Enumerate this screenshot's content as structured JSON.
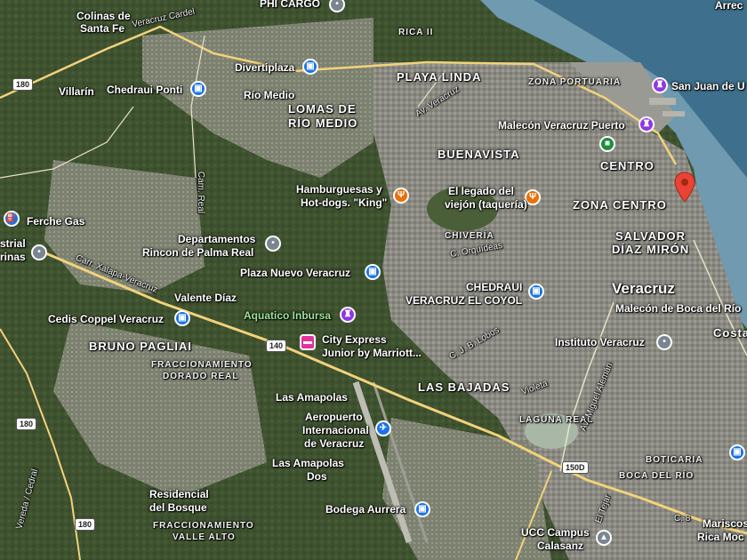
{
  "map": {
    "colors": {
      "sea": "#6f9ab0",
      "sea_deep": "#3e6f8c",
      "urban": "#8c8c84",
      "vegetation": "#3f5230",
      "road_major": "#f2d27a",
      "marker_red": "#ea4335"
    },
    "area_labels": [
      "Colinas de",
      "Santa Fe",
      "Villarín",
      "Río Medio",
      "LOMAS DE",
      "RÍO MEDIO",
      "PLAYA LINDA",
      "ZONA PORTUARIA",
      "BUENAVISTA",
      "CENTRO",
      "ZONA CENTRO",
      "SALVADOR",
      "DÍAZ MIRÓN",
      "Veracruz",
      "CHIVERÍA",
      "Valente Díaz",
      "BRUNO PAGLIAI",
      "FRACCIONAMIENTO",
      "DORADO REAL",
      "LAS BAJADAS",
      "LAGUNA REAL",
      "Las Amapolas",
      "Las Amapolas",
      "Dos",
      "Residencial",
      "del Bosque",
      "FRACCIONAMIENTO",
      "VALLE ALTO",
      "BOTICARIA",
      "BOCA DEL RÍO",
      "Arrec",
      "Costa",
      "RICA II",
      "strial",
      "rinas"
    ],
    "road_labels": [
      "Veracruz Cardel",
      "Av. Veracruz",
      "Carr. Xalapa-Veracruz",
      "Cam. Real",
      "C. Orquídeas",
      "C. J. B. Lobos",
      "Violeta",
      "Av. Miguel Alemán",
      "Vereda / Cedral",
      "El Tejar",
      "C. 8"
    ],
    "route_shields": [
      "180",
      "180",
      "180",
      "140",
      "150D"
    ],
    "places": [
      {
        "name": "PHI CARGO",
        "icon": "place-icon"
      },
      {
        "name": "Divertiplaza",
        "icon": "shopping-icon"
      },
      {
        "name": "Chedraui Ponti",
        "icon": "shopping-icon"
      },
      {
        "name": "San Juan de U",
        "icon": "landmark-icon"
      },
      {
        "name": "Malecón Veracruz Puerto",
        "icon": "landmark-icon"
      },
      {
        "name": "Hamburguesas y",
        "icon": "restaurant-icon"
      },
      {
        "name": "Hot-dogs. \"King\"",
        "icon": ""
      },
      {
        "name": "El legado del",
        "icon": "restaurant-icon"
      },
      {
        "name": "viejón (taquería)",
        "icon": ""
      },
      {
        "name": "Ferche Gas",
        "icon": "gas-station-icon"
      },
      {
        "name": "Departamentos",
        "icon": "place-icon"
      },
      {
        "name": "Rincon de Palma Real",
        "icon": ""
      },
      {
        "name": "Plaza Nuevo Veracruz",
        "icon": "shopping-icon"
      },
      {
        "name": "CHEDRAUI",
        "icon": "shopping-icon"
      },
      {
        "name": "VERACRUZ EL COYOL",
        "icon": ""
      },
      {
        "name": "Malecón de Boca del Río",
        "icon": ""
      },
      {
        "name": "Cedis Coppel Veracruz",
        "icon": "shopping-icon"
      },
      {
        "name": "Aquatico Inbursa",
        "icon": "landmark-icon"
      },
      {
        "name": "City Express",
        "icon": "hotel-icon"
      },
      {
        "name": "Junior by Marriott...",
        "icon": ""
      },
      {
        "name": "Instituto Veracruz",
        "icon": "place-icon"
      },
      {
        "name": "Aeropuerto",
        "icon": "airport-icon"
      },
      {
        "name": "Internacional",
        "icon": ""
      },
      {
        "name": "de Veracruz",
        "icon": ""
      },
      {
        "name": "Bodega Aurrera",
        "icon": "shopping-icon"
      },
      {
        "name": "UCC Campus",
        "icon": "school-icon"
      },
      {
        "name": "Calasanz",
        "icon": ""
      },
      {
        "name": "Mariscos",
        "icon": ""
      },
      {
        "name": "Rica Moc",
        "icon": ""
      }
    ]
  }
}
